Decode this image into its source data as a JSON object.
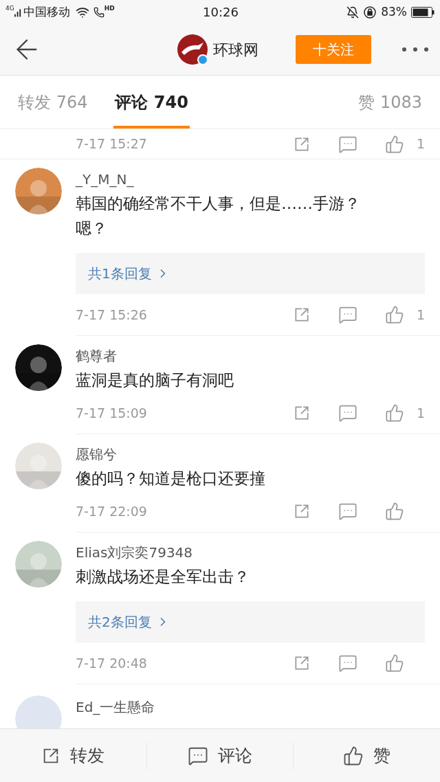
{
  "status_bar": {
    "network": "4G",
    "carrier": "中国移动",
    "hd": "HD",
    "time": "10:26",
    "battery": "83%"
  },
  "header": {
    "account": "环球网",
    "verified": true,
    "follow_button": "十关注"
  },
  "tabs": [
    {
      "label": "转发 764",
      "selected": false
    },
    {
      "label": "评论 740",
      "selected": true
    },
    {
      "label": "赞 1083",
      "selected": false
    }
  ],
  "comments": [
    {
      "kind": "partial_top",
      "time": "7-17 15:27",
      "likes": "1"
    },
    {
      "kind": "full",
      "name": "_Y_M_N_",
      "text": "韩国的确经常不干人事，但是……手游？嗯？",
      "replies": "共1条回复",
      "time": "7-17 15:26",
      "likes": "1"
    },
    {
      "kind": "full",
      "name": "鹤尊者",
      "text": "蓝洞是真的脑子有洞吧",
      "time": "7-17 15:09",
      "likes": "1"
    },
    {
      "kind": "full",
      "name": "愿锦兮",
      "text": "傻的吗？知道是枪口还要撞",
      "time": "7-17 22:09"
    },
    {
      "kind": "full",
      "name": "Elias刘宗奕79348",
      "text": "刺激战场还是全军出击？",
      "replies": "共2条回复",
      "time": "7-17 20:48"
    },
    {
      "kind": "partial_bottom",
      "name": "Ed_一生懸命"
    }
  ],
  "bottom_bar": [
    "转发",
    "评论",
    "赞"
  ]
}
